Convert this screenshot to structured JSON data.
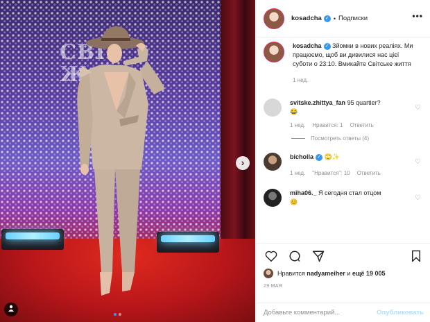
{
  "photo": {
    "brand_text_line1": "СВІТ",
    "brand_text_line2": "Ж",
    "next_label": "›",
    "tag_icon": "person-tag-icon",
    "slides": 2,
    "active_slide": 1
  },
  "header": {
    "username": "kosadcha",
    "separator": "•",
    "follow_label": "Подписки",
    "more_label": "•••"
  },
  "caption": {
    "username": "kosadcha",
    "text": "Зйомки в нових реаліях. Ми працюємо, щоб ви дивилися нас цієї суботи о 23:10. Вмикайте Світське життя",
    "time": "1 нед."
  },
  "comments": [
    {
      "username": "svitske.zhittya_fan",
      "text": "95 quartier?",
      "emoji": "😂",
      "time": "1 нед.",
      "likes": "Нравится: 1",
      "reply": "Ответить",
      "view_replies": "Посмотреть ответы (4)"
    },
    {
      "username": "bicholla",
      "text": "🙄✨",
      "time": "1 нед.",
      "likes": "\"Нравится\": 10",
      "reply": "Ответить"
    },
    {
      "username": "miha06._",
      "text": "Я сегодня стал отцом",
      "emoji": "😊"
    }
  ],
  "actions": {
    "likes_prefix": "Нравится",
    "likes_user": "nadyameiher",
    "likes_and": "и",
    "likes_more": "ещё 19 005",
    "date": "29 МАЯ"
  },
  "add_comment": {
    "placeholder": "Добавьте комментарий...",
    "publish": "Опубликовать"
  },
  "colors": {
    "accent": "#3897f0",
    "muted": "#8e8e8e",
    "publish_disabled": "#b2dffc"
  }
}
